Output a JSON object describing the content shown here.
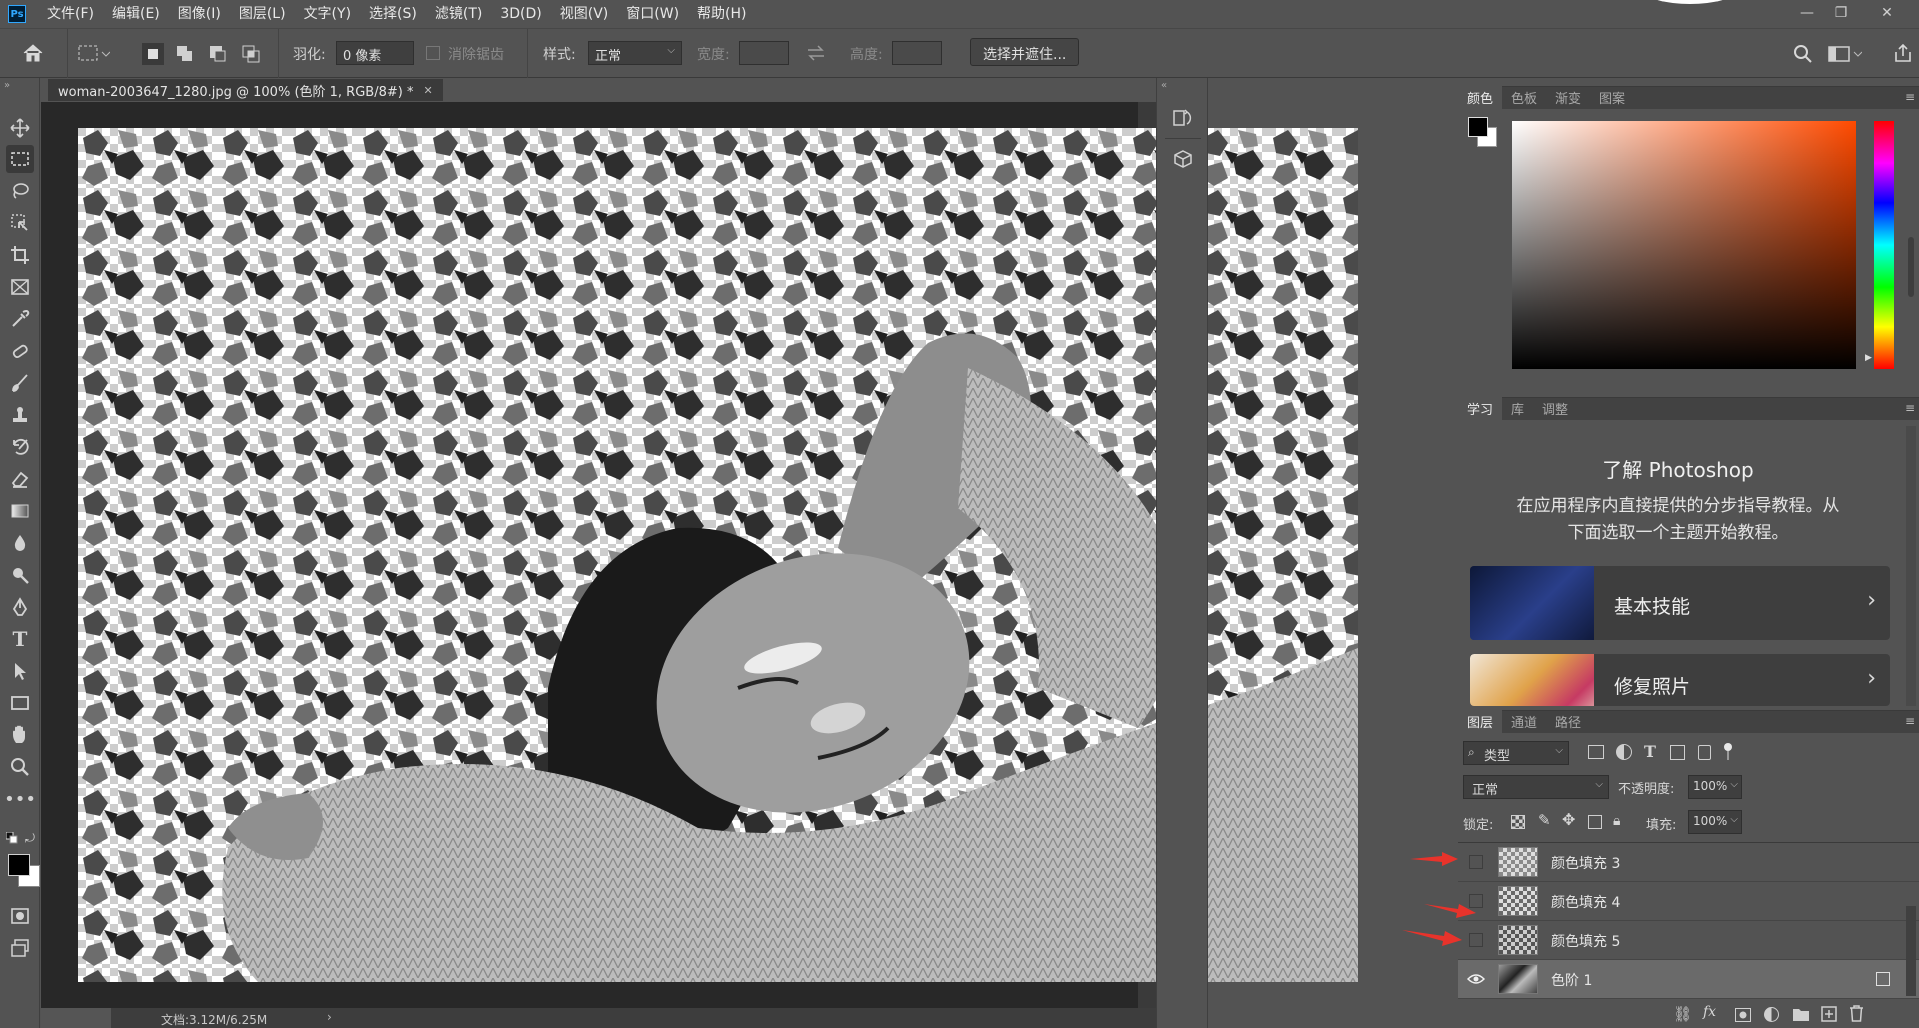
{
  "menubar": {
    "items": [
      "文件(F)",
      "编辑(E)",
      "图像(I)",
      "图层(L)",
      "文字(Y)",
      "选择(S)",
      "滤镜(T)",
      "3D(D)",
      "视图(V)",
      "窗口(W)",
      "帮助(H)"
    ],
    "logo": "Ps"
  },
  "options": {
    "feather_label": "羽化:",
    "feather_value": "0 像素",
    "antialias_label": "消除锯齿",
    "style_label": "样式:",
    "style_value": "正常",
    "width_label": "宽度:",
    "height_label": "高度:",
    "select_mask_button": "选择并遮住..."
  },
  "document": {
    "tab_title": "woman-2003647_1280.jpg @ 100% (色阶 1, RGB/8#) *",
    "status": "文档:3.12M/6.25M"
  },
  "color_panel": {
    "tabs": [
      "颜色",
      "色板",
      "渐变",
      "图案"
    ],
    "hue_color": "#ff4a00"
  },
  "learn_panel": {
    "tabs": [
      "学习",
      "库",
      "调整"
    ],
    "title": "了解 Photoshop",
    "description_line1": "在应用程序内直接提供的分步指导教程。从",
    "description_line2": "下面选取一个主题开始教程。",
    "cards": [
      {
        "label": "基本技能"
      },
      {
        "label": "修复照片"
      }
    ]
  },
  "layers_panel": {
    "tabs": [
      "图层",
      "通道",
      "路径"
    ],
    "filter_value": "类型",
    "blend_mode": "正常",
    "opacity_label": "不透明度:",
    "opacity_value": "100%",
    "lock_label": "锁定:",
    "fill_label": "填充:",
    "fill_value": "100%",
    "layers": [
      {
        "name": "颜色填充 3",
        "visible": false,
        "annotated": true
      },
      {
        "name": "颜色填充 4",
        "visible": false,
        "annotated": true
      },
      {
        "name": "颜色填充 5",
        "visible": false,
        "annotated": true
      },
      {
        "name": "色阶 1",
        "visible": true,
        "selected": true,
        "annotated": false
      }
    ]
  },
  "colors": {
    "accent_blue": "#31a8ff",
    "annotation_red": "#e8332b"
  }
}
